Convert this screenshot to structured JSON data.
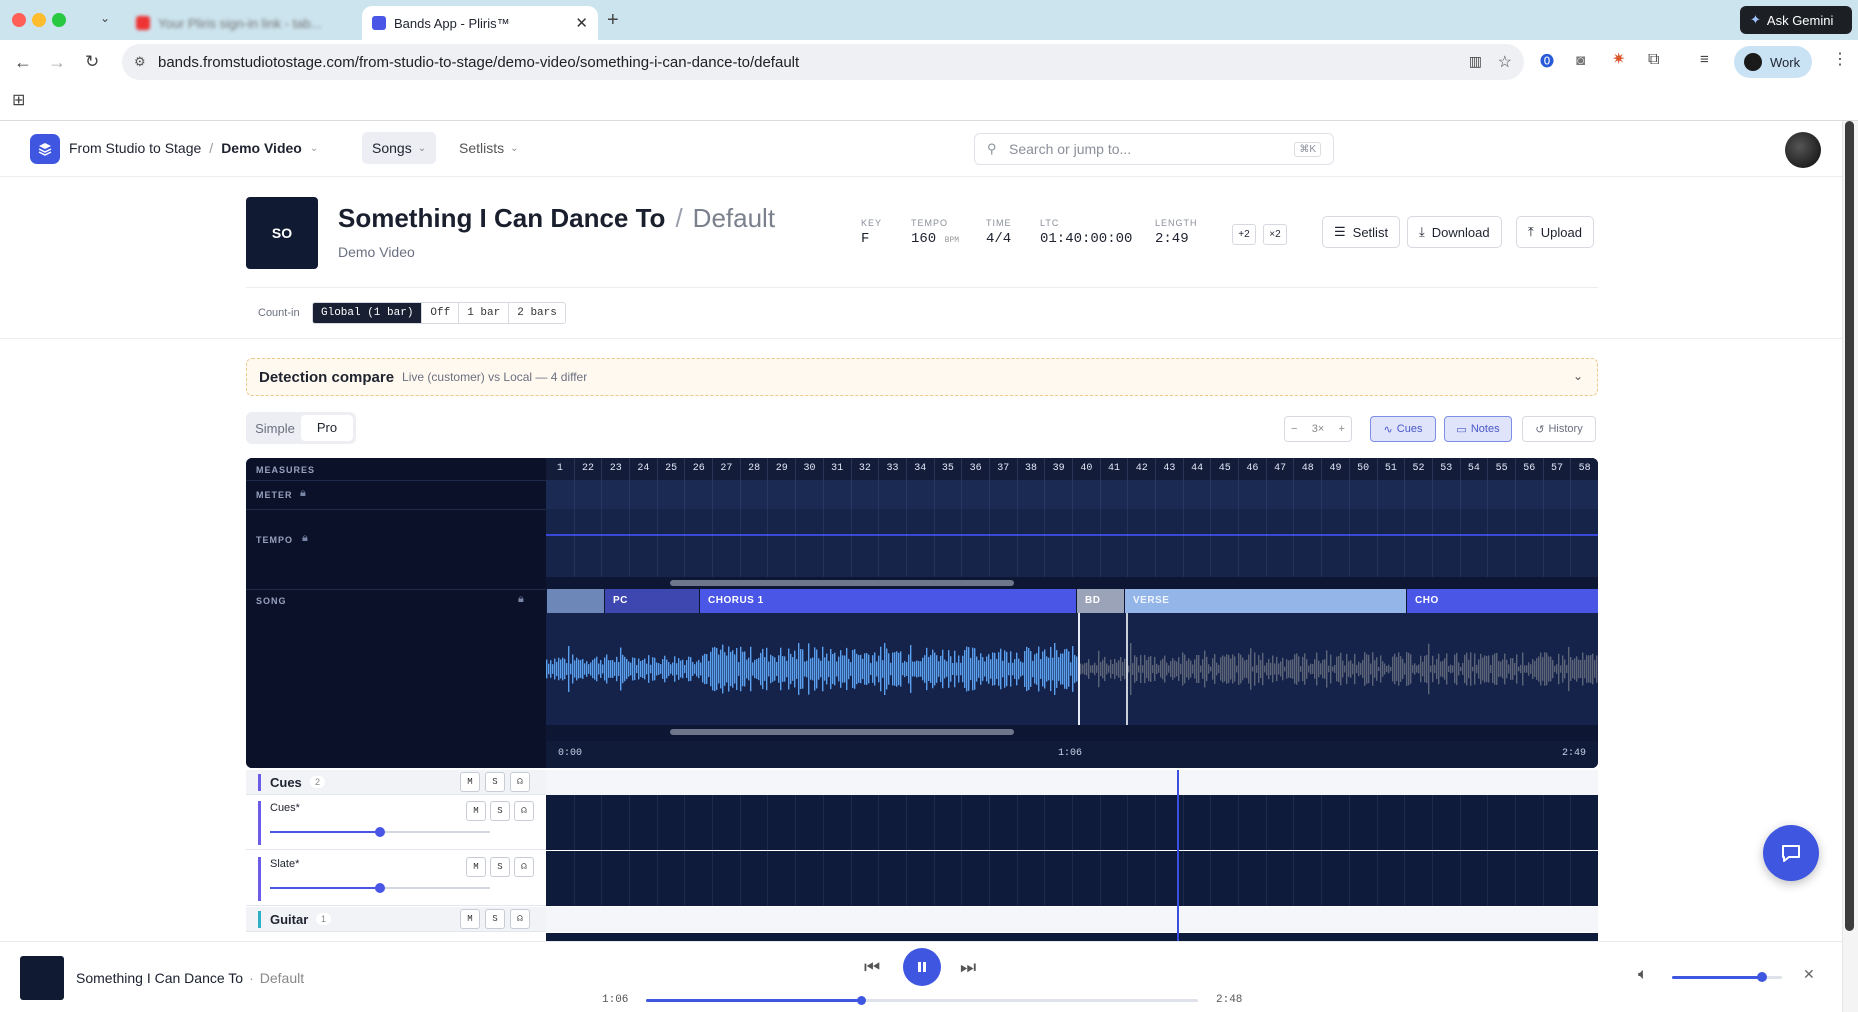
{
  "browser": {
    "tabs": [
      {
        "label": "Your Pliris sign-in link - tab..."
      },
      {
        "label": "Bands App - Pliris™"
      }
    ],
    "url": "bands.fromstudiotostage.com/from-studio-to-stage/demo-video/something-i-can-dance-to/default",
    "ask_gemini": "Ask Gemini",
    "profile": "Work"
  },
  "app": {
    "breadcrumb": {
      "org": "From Studio to Stage",
      "project": "Demo Video"
    },
    "nav": {
      "songs": "Songs",
      "setlists": "Setlists"
    },
    "search": {
      "placeholder": "Search or jump to...",
      "shortcut": "⌘K"
    }
  },
  "song": {
    "initials": "SO",
    "title": "Something I Can Dance To",
    "separator": "/",
    "arrangement": "Default",
    "project": "Demo Video",
    "meta": {
      "key_label": "KEY",
      "key": "F",
      "tempo_label": "TEMPO",
      "tempo": "160",
      "tempo_unit": "BPM",
      "time_label": "TIME",
      "time": "4/4",
      "ltc_label": "LTC",
      "ltc": "01:40:00:00",
      "length_label": "LENGTH",
      "length": "2:49"
    },
    "transpose": [
      "+2",
      "×2"
    ],
    "actions": {
      "setlist": "Setlist",
      "download": "Download",
      "upload": "Upload"
    }
  },
  "countin": {
    "label": "Count-in",
    "options": [
      "Global (1 bar)",
      "Off",
      "1 bar",
      "2 bars"
    ],
    "selected": 0
  },
  "detection": {
    "title": "Detection compare",
    "subtitle": "Live (customer) vs Local — 4 differ"
  },
  "view_toggle": {
    "simple": "Simple",
    "pro": "Pro",
    "selected": "Pro"
  },
  "toolbar": {
    "zoom": "3×",
    "minus": "−",
    "plus": "+",
    "cues": "Cues",
    "notes": "Notes",
    "history": "History"
  },
  "timeline": {
    "measures_label": "MEASURES",
    "meter_label": "METER",
    "tempo_label": "TEMPO",
    "song_label": "SONG",
    "measures": [
      "1",
      "22",
      "23",
      "24",
      "25",
      "26",
      "27",
      "28",
      "29",
      "30",
      "31",
      "32",
      "33",
      "34",
      "35",
      "36",
      "37",
      "38",
      "39",
      "40",
      "41",
      "42",
      "43",
      "44",
      "45",
      "46",
      "47",
      "48",
      "49",
      "50",
      "51",
      "52",
      "53",
      "54",
      "55",
      "56",
      "57",
      "58"
    ],
    "sections": [
      {
        "label": "",
        "color": "#6d88b8"
      },
      {
        "label": "PC",
        "color": "#3e47b0"
      },
      {
        "label": "CHORUS 1",
        "color": "#4a57e6"
      },
      {
        "label": "BD",
        "color": "#9aa3b8"
      },
      {
        "label": "VERSE",
        "color": "#93b5e8"
      },
      {
        "label": "CHO",
        "color": "#4a57e6"
      }
    ],
    "time_start": "0:00",
    "time_mid": "1:06",
    "time_end": "2:49"
  },
  "tracks": {
    "cues_group": {
      "name": "Cues",
      "count": "2"
    },
    "cues_track": {
      "name": "Cues*",
      "volume": 0.5
    },
    "slate_track": {
      "name": "Slate*",
      "volume": 0.5
    },
    "guitar_group": {
      "name": "Guitar",
      "count": "1"
    },
    "btn_mute": "M",
    "btn_solo": "S"
  },
  "player": {
    "title": "Something I Can Dance To",
    "separator": "·",
    "arrangement": "Default",
    "elapsed": "1:06",
    "remaining": "2:48",
    "progress": 0.39,
    "volume": 0.82
  }
}
